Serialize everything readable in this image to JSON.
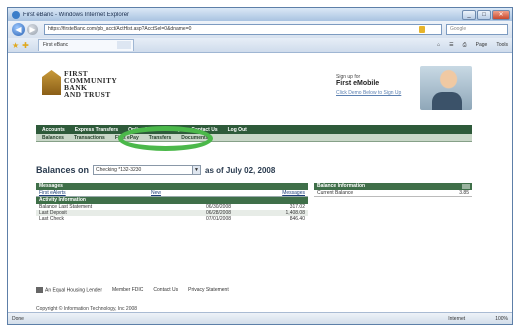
{
  "window": {
    "title": "First eBanc - Windows Internet Explorer",
    "url": "https://firsteBanc.com/pb_acct/ActHist.asp?AcctSel=0&dname=0",
    "search_placeholder": "Google",
    "tab_label": "First eBanc",
    "tools": [
      "Page",
      "Tools"
    ],
    "status_left": "Done",
    "status_zone": "Internet",
    "status_zoom": "100%"
  },
  "bank": {
    "logo_lines": [
      "FIRST",
      "COMMUNITY",
      "BANK",
      "AND TRUST"
    ],
    "promo_sub": "Sign up for",
    "promo_head": "First eMobile",
    "promo_link": "Click Demo Below to Sign Up"
  },
  "main_nav": [
    "Accounts",
    "Express Transfers",
    "Online Forms",
    "Help",
    "Contact Us",
    "Log Out"
  ],
  "sub_nav": [
    "Balances",
    "Transactions",
    "First ePay",
    "Transfers",
    "Documents"
  ],
  "balances": {
    "label": "Balances on",
    "account": "Checking *132-3230",
    "as_of": "as of July 02, 2008"
  },
  "messages": {
    "header": "Messages",
    "columns": [
      "First eAlerts",
      "New",
      "Messages"
    ],
    "activity_header": "Activity Information",
    "rows": [
      {
        "label": "Balance Last Statement",
        "date": "06/30/2008",
        "amount": "317.02"
      },
      {
        "label": "Last Deposit",
        "date": "06/28/2008",
        "amount": "1,408.08"
      },
      {
        "label": "Last Check",
        "date": "07/01/2008",
        "amount": "846.40"
      }
    ]
  },
  "balance_info": {
    "header": "Balance Information",
    "label": "Current Balance",
    "value": "3.85"
  },
  "footer": {
    "links": [
      "An Equal Housing Lender",
      "Member FDIC",
      "Contact Us",
      "Privacy Statement"
    ],
    "copyright": "Copyright © Information Technology, Inc 2008"
  }
}
